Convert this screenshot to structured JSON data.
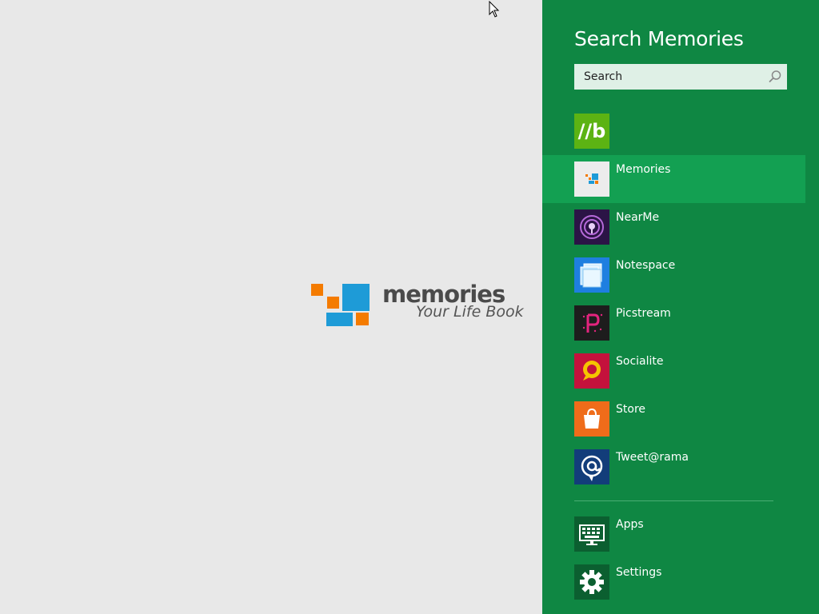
{
  "app": {
    "logo_word": "memories",
    "logo_tagline": "Your Life Book",
    "colors": {
      "background": "#e8e8e8",
      "logo_orange": "#f47b00",
      "logo_blue": "#1e9bd7"
    }
  },
  "charm": {
    "title": "Search Memories",
    "search": {
      "placeholder": "Search",
      "value": ""
    },
    "bing_tile_label": "//b",
    "colors": {
      "pane": "#0f8743",
      "selected_row": "#13a052"
    },
    "apps": [
      {
        "label": "Memories",
        "icon": "memories-app-icon",
        "selected": true
      },
      {
        "label": "NearMe",
        "icon": "nearme-app-icon"
      },
      {
        "label": "Notespace",
        "icon": "notespace-app-icon"
      },
      {
        "label": "Picstream",
        "icon": "picstream-app-icon"
      },
      {
        "label": "Socialite",
        "icon": "socialite-app-icon"
      },
      {
        "label": "Store",
        "icon": "store-app-icon"
      },
      {
        "label": "Tweet@rama",
        "icon": "tweetarama-app-icon"
      }
    ],
    "system": [
      {
        "label": "Apps",
        "icon": "apps-keyboard-icon"
      },
      {
        "label": "Settings",
        "icon": "settings-gear-icon"
      }
    ]
  }
}
